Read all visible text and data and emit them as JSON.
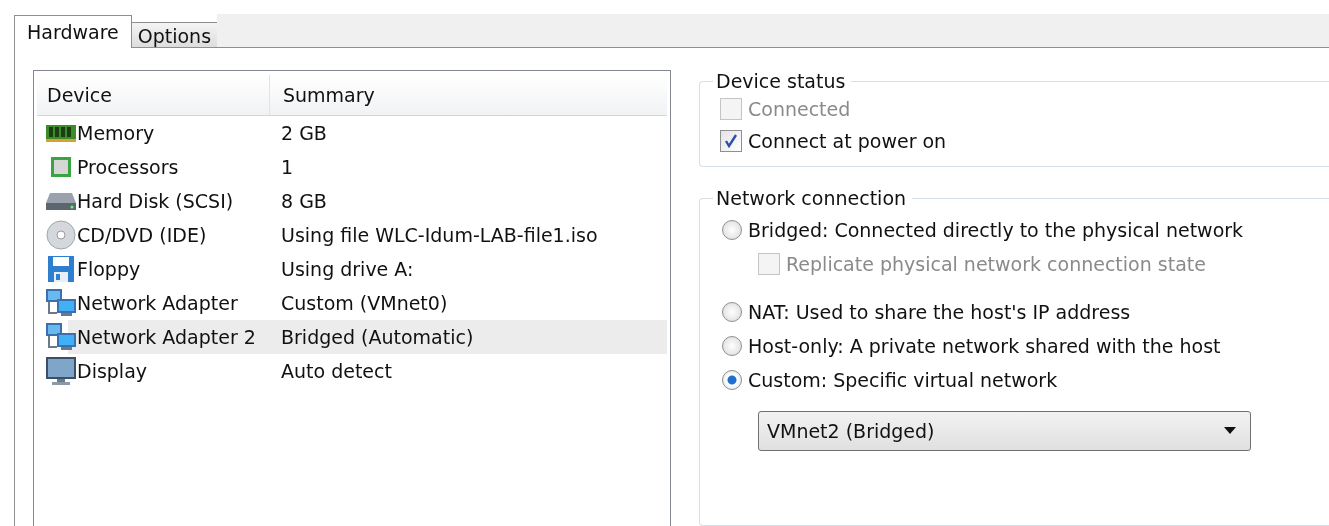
{
  "tabs": [
    {
      "label": "Hardware",
      "selected": true
    },
    {
      "label": "Options",
      "selected": false
    }
  ],
  "device_table": {
    "columns": [
      "Device",
      "Summary"
    ],
    "rows": [
      {
        "kind": "memory",
        "device": "Memory",
        "summary": "2 GB",
        "selected": false
      },
      {
        "kind": "processor",
        "device": "Processors",
        "summary": "1",
        "selected": false
      },
      {
        "kind": "disk",
        "device": "Hard Disk (SCSI)",
        "summary": "8 GB",
        "selected": false
      },
      {
        "kind": "cd",
        "device": "CD/DVD (IDE)",
        "summary": "Using file WLC-Idum-LAB-file1.iso",
        "selected": false
      },
      {
        "kind": "floppy",
        "device": "Floppy",
        "summary": "Using drive A:",
        "selected": false
      },
      {
        "kind": "network",
        "device": "Network Adapter",
        "summary": "Custom (VMnet0)",
        "selected": false
      },
      {
        "kind": "network",
        "device": "Network Adapter 2",
        "summary": "Bridged (Automatic)",
        "selected": true
      },
      {
        "kind": "display",
        "device": "Display",
        "summary": "Auto detect",
        "selected": false
      }
    ]
  },
  "device_status": {
    "title": "Device status",
    "options": [
      {
        "label": "Connected",
        "checked": false,
        "disabled": true
      },
      {
        "label": "Connect at power on",
        "checked": true,
        "disabled": false
      }
    ]
  },
  "network_connection": {
    "title": "Network connection",
    "options": [
      {
        "label": "Bridged: Connected directly to the physical network",
        "selected": false,
        "sub_option": {
          "label": "Replicate physical network connection state",
          "checked": false,
          "disabled": true
        }
      },
      {
        "label": "NAT: Used to share the host's IP address",
        "selected": false
      },
      {
        "label": "Host-only: A private network shared with the host",
        "selected": false
      },
      {
        "label": "Custom: Specific virtual network",
        "selected": true
      }
    ],
    "dropdown": {
      "value": "VMnet2 (Bridged)"
    }
  }
}
